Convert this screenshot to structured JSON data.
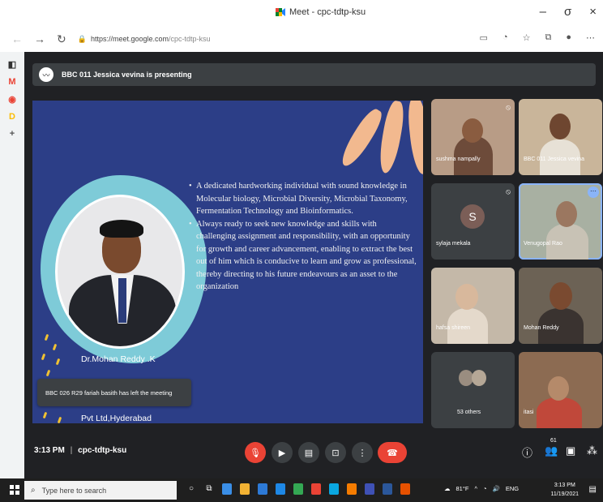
{
  "browser": {
    "tab_title": "Meet - cpc-tdtp-ksu",
    "url_domain": "https://meet.google.com",
    "url_path": "/cpc-tdtp-ksu",
    "window_controls": [
      "–",
      "σ",
      "×"
    ]
  },
  "sidepanel": {
    "items": [
      "◧",
      "M",
      "◉",
      "D",
      "+"
    ]
  },
  "meet": {
    "presenting_text": "BBC 011 Jessica vevina is presenting",
    "meeting_time": "3:13 PM",
    "meeting_code": "cpc-tdtp-ksu",
    "participant_badge": "61"
  },
  "slide": {
    "bullet1": "A dedicated hardworking individual with sound knowledge in Molecular biology, Microbial Diversity, Microbial Taxonomy, Fermentation Technology and Bioinformatics.",
    "bullet2": "Always ready to seek new knowledge and skills with challenging assignment and responsibility, with an opportunity for growth and career advancement, enabling to extract the best out of him which is conducive to learn and grow as professional, thereby directing to his future endeavours as an asset to the organization",
    "name": "Dr.Mohan Reddy .K",
    "company": "Pvt Ltd,Hyderabad"
  },
  "notification": {
    "text": "BBC 026 R29 fariah basith has left the meeting"
  },
  "tiles": [
    {
      "label": "sushma nampally"
    },
    {
      "label": "BBC 011 Jessica vevina"
    },
    {
      "label": "sylaja mekala",
      "initial": "S"
    },
    {
      "label": "Venugopal Rao"
    },
    {
      "label": "hafsa shireen"
    },
    {
      "label": "Mohan Reddy"
    },
    {
      "label": "53 others"
    },
    {
      "label": "itasi"
    }
  ],
  "taskbar": {
    "search_placeholder": "Type here to search",
    "weather": "81°F",
    "language": "ENG",
    "time": "3:13 PM",
    "date": "11/19/2021"
  }
}
